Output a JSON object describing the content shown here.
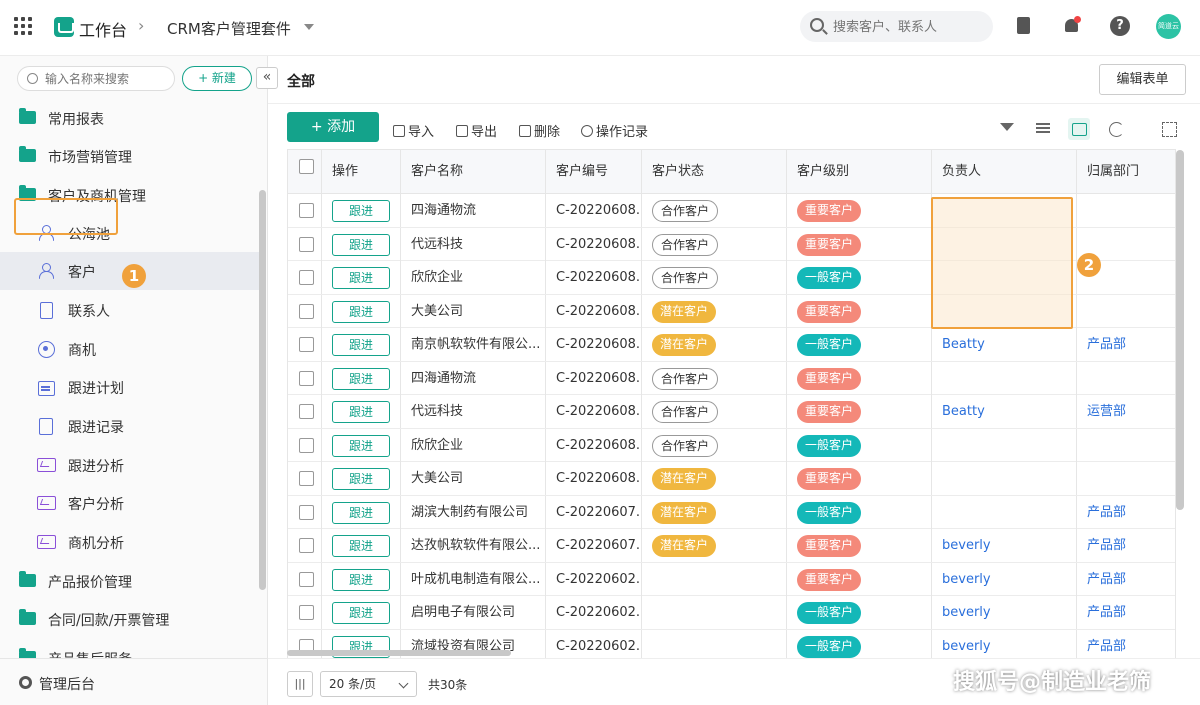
{
  "topbar": {
    "app_title": "工作台",
    "crumb_sep": "›",
    "suite_name": "CRM客户管理套件",
    "search_placeholder": "搜索客户、联系人",
    "help_glyph": "?",
    "avatar_text": "简道云"
  },
  "sidebar": {
    "search_placeholder": "输入名称来搜索",
    "new_label": "+ 新建",
    "collapse_glyph": "«",
    "groups": [
      {
        "label": "常用报表",
        "icon": "folder-icon"
      },
      {
        "label": "市场营销管理",
        "icon": "folder-icon"
      },
      {
        "label": "客户及商机管理",
        "icon": "folder-open-icon"
      }
    ],
    "items": [
      {
        "label": "公海池",
        "icon": "person-icon"
      },
      {
        "label": "客户",
        "icon": "person-icon"
      },
      {
        "label": "联系人",
        "icon": "contact-book-icon"
      },
      {
        "label": "商机",
        "icon": "target-icon"
      },
      {
        "label": "跟进计划",
        "icon": "calendar-icon"
      },
      {
        "label": "跟进记录",
        "icon": "document-icon"
      },
      {
        "label": "跟进分析",
        "icon": "chart-icon"
      },
      {
        "label": "客户分析",
        "icon": "chart-icon"
      },
      {
        "label": "商机分析",
        "icon": "chart-icon"
      }
    ],
    "groups_after": [
      {
        "label": "产品报价管理",
        "icon": "folder-icon"
      },
      {
        "label": "合同/回款/开票管理",
        "icon": "folder-icon"
      },
      {
        "label": "产品售后服务",
        "icon": "folder-icon"
      }
    ],
    "admin_label": "管理后台",
    "marker_1": "1"
  },
  "main": {
    "title": "全部",
    "edit_form_label": "编辑表单",
    "add_label": "+ 添加",
    "toolbar": {
      "import": "导入",
      "export": "导出",
      "delete": "删除",
      "history": "操作记录"
    },
    "marker_2": "2"
  },
  "table": {
    "columns": [
      "操作",
      "客户名称",
      "客户编号",
      "客户状态",
      "客户级别",
      "负责人",
      "归属部门"
    ],
    "follow_label": "跟进",
    "rows": [
      {
        "name": "四海通物流",
        "code": "C-20220608...",
        "status": "合作客户",
        "level": "重要客户",
        "owner": "",
        "dept": ""
      },
      {
        "name": "代远科技",
        "code": "C-20220608...",
        "status": "合作客户",
        "level": "重要客户",
        "owner": "",
        "dept": ""
      },
      {
        "name": "欣欣企业",
        "code": "C-20220608...",
        "status": "合作客户",
        "level": "一般客户",
        "owner": "",
        "dept": ""
      },
      {
        "name": "大美公司",
        "code": "C-20220608...",
        "status": "潜在客户",
        "level": "重要客户",
        "owner": "",
        "dept": ""
      },
      {
        "name": "南京帆软软件有限公...",
        "code": "C-20220608...",
        "status": "潜在客户",
        "level": "一般客户",
        "owner": "Beatty",
        "dept": "产品部"
      },
      {
        "name": "四海通物流",
        "code": "C-20220608...",
        "status": "合作客户",
        "level": "重要客户",
        "owner": "",
        "dept": ""
      },
      {
        "name": "代远科技",
        "code": "C-20220608...",
        "status": "合作客户",
        "level": "重要客户",
        "owner": "Beatty",
        "dept": "运营部"
      },
      {
        "name": "欣欣企业",
        "code": "C-20220608...",
        "status": "合作客户",
        "level": "一般客户",
        "owner": "",
        "dept": ""
      },
      {
        "name": "大美公司",
        "code": "C-20220608...",
        "status": "潜在客户",
        "level": "重要客户",
        "owner": "",
        "dept": ""
      },
      {
        "name": "湖滨大制药有限公司",
        "code": "C-20220607...",
        "status": "潜在客户",
        "level": "一般客户",
        "owner": "",
        "dept": "产品部"
      },
      {
        "name": "达孜帆软软件有限公...",
        "code": "C-20220607...",
        "status": "潜在客户",
        "level": "重要客户",
        "owner": "beverly",
        "dept": "产品部"
      },
      {
        "name": "叶成机电制造有限公...",
        "code": "C-20220602...",
        "status": "",
        "level": "重要客户",
        "owner": "beverly",
        "dept": "产品部"
      },
      {
        "name": "启明电子有限公司",
        "code": "C-20220602...",
        "status": "",
        "level": "一般客户",
        "owner": "beverly",
        "dept": "产品部"
      },
      {
        "name": "流域投资有限公司",
        "code": "C-20220602...",
        "status": "",
        "level": "一般客户",
        "owner": "beverly",
        "dept": "产品部"
      }
    ]
  },
  "footer": {
    "pager_glyph": "|||",
    "page_size": "20 条/页",
    "total": "共30条"
  },
  "watermark": "搜狐号@制造业老筛",
  "colors": {
    "accent": "#14a38b",
    "highlight": "#f0a13c",
    "potential": "#f0b73f",
    "important": "#f4897a",
    "normal": "#14b8b8",
    "link": "#2a6fdb"
  }
}
